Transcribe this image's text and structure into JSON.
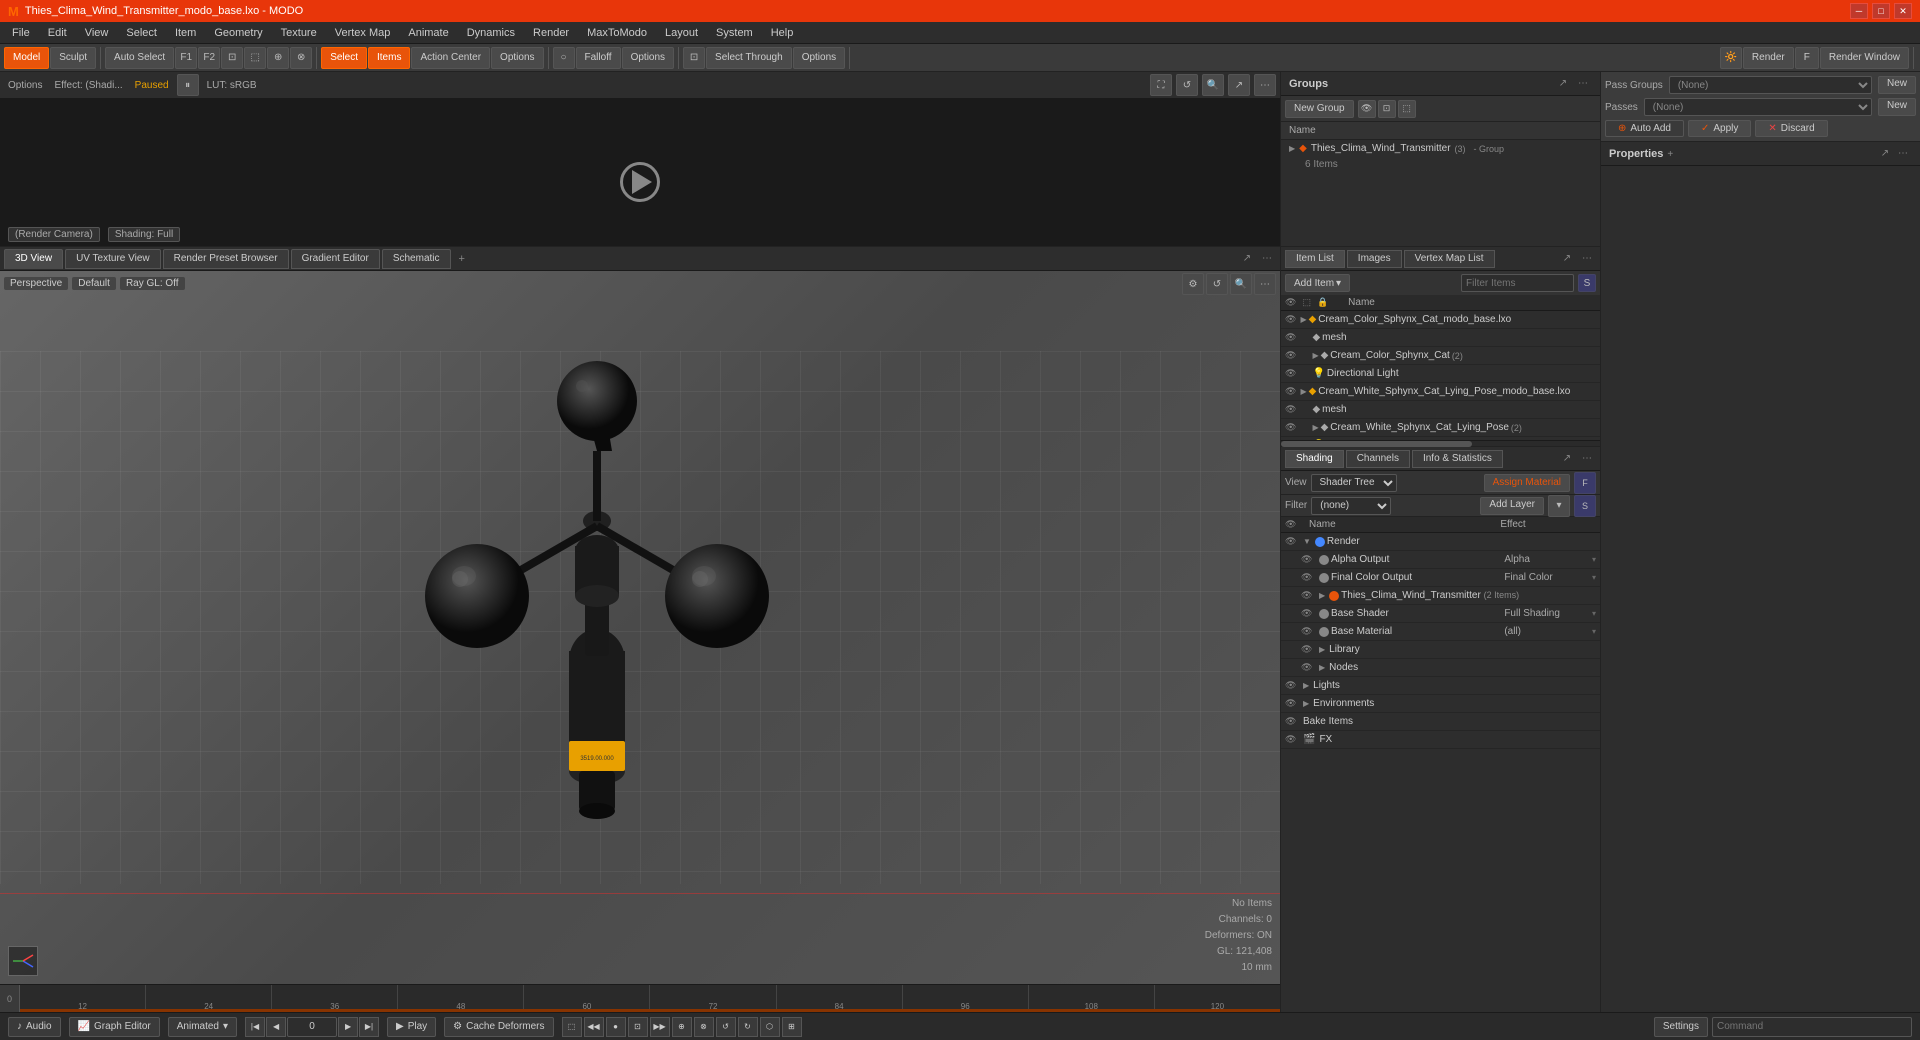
{
  "titlebar": {
    "title": "Thies_Clima_Wind_Transmitter_modo_base.lxo - MODO",
    "minimize": "─",
    "restore": "□",
    "close": "✕"
  },
  "menubar": {
    "items": [
      "File",
      "Edit",
      "View",
      "Select",
      "Item",
      "Geometry",
      "Texture",
      "Vertex Map",
      "Animate",
      "Dynamics",
      "Render",
      "MaxToModo",
      "Layout",
      "System",
      "Help"
    ]
  },
  "toolbar": {
    "left_items": [
      "Model",
      "Sculpt"
    ],
    "auto_select": "Auto Select",
    "f1": "F1",
    "f2": "F2",
    "select_btn": "Select",
    "items_btn": "Items",
    "action_center": "Action Center",
    "options_btn": "Options",
    "falloff_label": "Falloff",
    "falloff_options": "Options",
    "select_through": "Select Through",
    "select_through_options": "Options",
    "render_btn": "Render",
    "render_frame": "F",
    "render_window": "Render Window"
  },
  "preview": {
    "options_label": "Options",
    "effect_label": "Effect: (Shadi...",
    "paused_label": "Paused",
    "lut_label": "LUT: sRGB",
    "render_camera_label": "(Render Camera)",
    "shading_label": "Shading: Full"
  },
  "viewport_tabs": {
    "tabs": [
      "3D View",
      "UV Texture View",
      "Render Preset Browser",
      "Gradient Editor",
      "Schematic"
    ],
    "plus": "+"
  },
  "viewport": {
    "perspective_label": "Perspective",
    "default_label": "Default",
    "ray_gl_label": "Ray GL: Off",
    "stats": {
      "no_items": "No Items",
      "channels": "Channels: 0",
      "deformers": "Deformers: ON",
      "gl": "GL: 121,408",
      "scale": "10 mm"
    }
  },
  "timeline": {
    "marks": [
      "0",
      "12",
      "24",
      "36",
      "48",
      "60",
      "72",
      "84",
      "96",
      "108",
      "120"
    ],
    "range_start": "0",
    "range_end": "120"
  },
  "groups": {
    "title": "Groups",
    "new_group_btn": "New Group",
    "name_col": "Name",
    "items": [
      {
        "name": "Thies_Clima_Wind_Transmitter",
        "count": "(3)",
        "type": "Group",
        "sub_label": "6 Items",
        "expanded": true
      }
    ]
  },
  "pass_controls": {
    "auto_add_label": "Auto Add",
    "apply_label": "Apply",
    "discard_label": "Discard",
    "pass_groups_label": "Pass Groups",
    "passes_label": "Passes",
    "none_option": "(None)",
    "new_btn": "New"
  },
  "properties": {
    "title": "Properties"
  },
  "item_list": {
    "tabs": [
      "Item List",
      "Images",
      "Vertex Map List"
    ],
    "add_item_btn": "Add Item",
    "filter_placeholder": "Filter Items",
    "cols": [
      "Name"
    ],
    "items": [
      {
        "indent": 0,
        "name": "Cream_Color_Sphynx_Cat_modo_base.lxo",
        "icon": "📁",
        "type": "scene",
        "eye": true
      },
      {
        "indent": 1,
        "name": "mesh",
        "icon": "◆",
        "type": "mesh",
        "eye": true
      },
      {
        "indent": 1,
        "name": "Cream_Color_Sphynx_Cat",
        "icon": "◆",
        "type": "mesh",
        "count": "(2)",
        "eye": true
      },
      {
        "indent": 1,
        "name": "Directional Light",
        "icon": "💡",
        "type": "light",
        "eye": true
      },
      {
        "indent": 0,
        "name": "Cream_White_Sphynx_Cat_Lying_Pose_modo_base.lxo",
        "icon": "📁",
        "type": "scene",
        "eye": true
      },
      {
        "indent": 1,
        "name": "mesh",
        "icon": "◆",
        "type": "mesh",
        "eye": true
      },
      {
        "indent": 1,
        "name": "Cream_White_Sphynx_Cat_Lying_Pose",
        "icon": "◆",
        "type": "mesh",
        "count": "(2)",
        "eye": true
      },
      {
        "indent": 1,
        "name": "Directional Light",
        "icon": "💡",
        "type": "light",
        "eye": true
      }
    ]
  },
  "shading": {
    "tabs": [
      "Shading",
      "Channels",
      "Info & Statistics"
    ],
    "view_label": "View",
    "shader_tree_label": "Shader Tree",
    "assign_material_btn": "Assign Material",
    "filter_label": "Filter",
    "none_filter": "(none)",
    "add_layer_btn": "Add Layer",
    "cols": {
      "name": "Name",
      "effect": "Effect"
    },
    "items": [
      {
        "type": "render",
        "name": "Render",
        "effect": "",
        "level": 0,
        "has_arrow": true,
        "color": "#4488ff"
      },
      {
        "type": "output",
        "name": "Alpha Output",
        "effect": "Alpha",
        "level": 1,
        "has_arrow": false,
        "color": "#888"
      },
      {
        "type": "output",
        "name": "Final Color Output",
        "effect": "Final Color",
        "level": 1,
        "has_arrow": false,
        "color": "#888"
      },
      {
        "type": "scene",
        "name": "Thies_Clima_Wind_Transmitter",
        "extra": "(2 Items)",
        "effect": "",
        "level": 1,
        "has_arrow": true,
        "color": "#e8540a"
      },
      {
        "type": "shader",
        "name": "Base Shader",
        "effect": "Full Shading",
        "level": 1,
        "has_arrow": false,
        "color": "#888"
      },
      {
        "type": "material",
        "name": "Base Material",
        "effect": "(all)",
        "level": 1,
        "has_arrow": false,
        "color": "#888"
      },
      {
        "type": "folder",
        "name": "Library",
        "effect": "",
        "level": 1,
        "has_arrow": true,
        "color": "#888"
      },
      {
        "type": "folder",
        "name": "Nodes",
        "effect": "",
        "level": 1,
        "has_arrow": true,
        "color": "#888"
      },
      {
        "type": "folder",
        "name": "Lights",
        "effect": "",
        "level": 0,
        "has_arrow": true,
        "color": "#888"
      },
      {
        "type": "folder",
        "name": "Environments",
        "effect": "",
        "level": 0,
        "has_arrow": true,
        "color": "#888"
      },
      {
        "type": "folder",
        "name": "Bake Items",
        "effect": "",
        "level": 0,
        "has_arrow": false,
        "color": "#888"
      },
      {
        "type": "folder",
        "name": "FX",
        "effect": "",
        "level": 0,
        "has_arrow": false,
        "color": "#888",
        "icon": "🎬"
      }
    ]
  },
  "statusbar": {
    "audio_btn": "Audio",
    "graph_editor_btn": "Graph Editor",
    "animated_btn": "Animated",
    "frame_value": "0",
    "play_btn": "Play",
    "cache_deformers_btn": "Cache Deformers",
    "settings_btn": "Settings",
    "command_placeholder": "Command"
  }
}
